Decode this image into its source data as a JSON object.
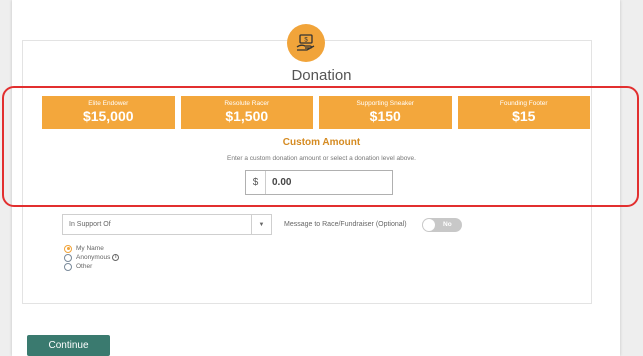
{
  "page": {
    "title": "Donation"
  },
  "donation_levels": [
    {
      "name": "Elite Endower",
      "amount": "$15,000"
    },
    {
      "name": "Resolute Racer",
      "amount": "$1,500"
    },
    {
      "name": "Supporting Sneaker",
      "amount": "$150"
    },
    {
      "name": "Founding Footer",
      "amount": "$15"
    }
  ],
  "custom_amount": {
    "title": "Custom Amount",
    "hint": "Enter a custom donation amount or select a donation level above.",
    "currency": "$",
    "value": "0.00"
  },
  "support": {
    "select_value": "In Support Of",
    "message_label": "Message to Race/Fundraiser (Optional)",
    "toggle_label": "No",
    "options": [
      "My Name",
      "Anonymous",
      "Other"
    ],
    "selected_option": "My Name"
  },
  "actions": {
    "continue_label": "Continue"
  },
  "colors": {
    "accent": "#f3a73c",
    "button": "#3a7a6f",
    "highlight": "#e22f2f"
  }
}
